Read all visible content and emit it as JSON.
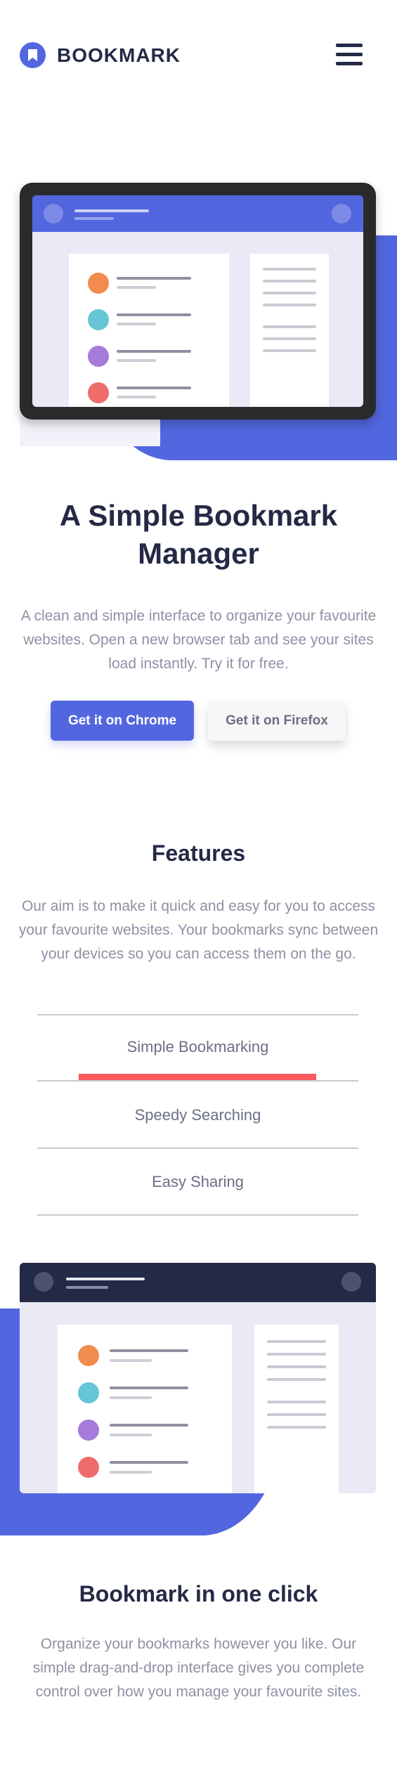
{
  "brand": {
    "name": "BOOKMARK",
    "accent": "#5267df",
    "dark": "#242a45",
    "red": "#fa5959"
  },
  "nav": {
    "menu_icon": "hamburger-icon"
  },
  "hero": {
    "title": "A Simple Bookmark Manager",
    "description": "A clean and simple interface to organize your favourite websites. Open a new browser tab and see your sites load instantly. Try it for free.",
    "buttons": {
      "chrome": "Get it on Chrome",
      "firefox": "Get it on Firefox"
    }
  },
  "features": {
    "title": "Features",
    "description": "Our aim is to make it quick and easy for you to access your favourite websites. Your bookmarks sync between your devices so you can access them on the go.",
    "tabs": [
      {
        "label": "Simple Bookmarking",
        "active": true
      },
      {
        "label": "Speedy Searching",
        "active": false
      },
      {
        "label": "Easy Sharing",
        "active": false
      }
    ]
  },
  "feature_detail": {
    "title": "Bookmark in one click",
    "description": "Organize your bookmarks however you like. Our simple drag-and-drop interface gives you complete control over how you manage your favourite sites."
  },
  "illustration": {
    "dot_colors": [
      "#f28b4e",
      "#66c5d6",
      "#a67ad8",
      "#ef6c6c"
    ]
  }
}
